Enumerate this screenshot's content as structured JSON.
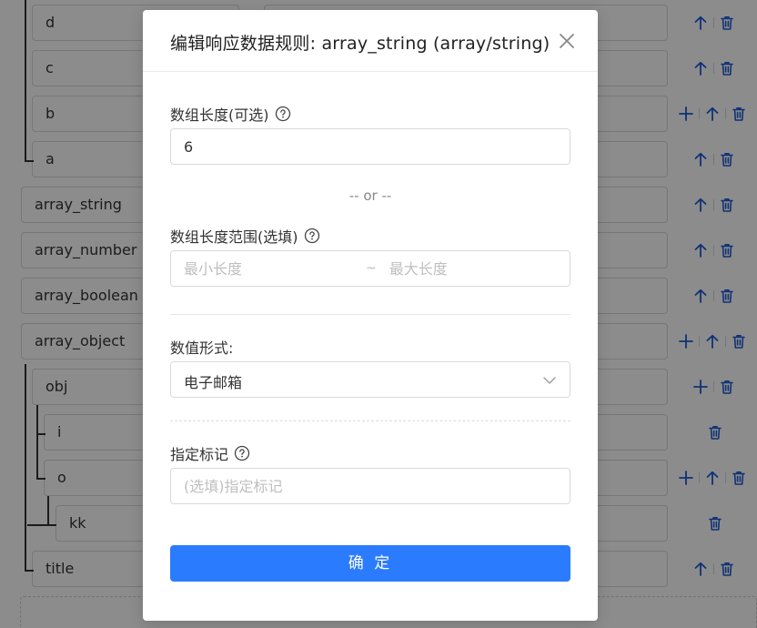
{
  "tree": {
    "rows": [
      {
        "name": "d",
        "actions": [
          "up",
          "delete"
        ]
      },
      {
        "name": "c",
        "actions": [
          "up",
          "delete"
        ]
      },
      {
        "name": "b",
        "actions": [
          "add",
          "up",
          "delete"
        ]
      },
      {
        "name": "a",
        "actions": [
          "up",
          "delete"
        ]
      },
      {
        "name": "array_string",
        "actions": [
          "up",
          "delete"
        ]
      },
      {
        "name": "array_number",
        "actions": [
          "up",
          "delete"
        ]
      },
      {
        "name": "array_boolean",
        "actions": [
          "up",
          "delete"
        ]
      },
      {
        "name": "array_object",
        "actions": [
          "add",
          "up",
          "delete"
        ]
      },
      {
        "name": "obj",
        "actions": [
          "add",
          "delete"
        ]
      },
      {
        "name": "i",
        "actions": [
          "delete"
        ]
      },
      {
        "name": "o",
        "actions": [
          "add",
          "up",
          "delete"
        ]
      },
      {
        "name": "kk",
        "actions": [
          "delete"
        ]
      },
      {
        "name": "title",
        "actions": [
          "up",
          "delete"
        ]
      }
    ]
  },
  "modal": {
    "title": "编辑响应数据规则: array_string (array/string)",
    "array_length_label": "数组长度(可选)",
    "array_length_value": "6",
    "or_text": "-- or --",
    "range_label": "数组长度范围(选填)",
    "range_min_placeholder": "最小长度",
    "range_sep": "~",
    "range_max_placeholder": "最大长度",
    "value_format_label": "数值形式:",
    "value_format_selected": "电子邮箱",
    "tag_label": "指定标记",
    "tag_placeholder": "(选填)指定标记",
    "confirm_label": "确 定"
  },
  "colors": {
    "primary": "#2b7bff",
    "action_icon": "#1d5bd6"
  },
  "icons": {
    "close": "close-icon",
    "help": "help-circle-icon",
    "select_arrow": "chevron-down-icon",
    "add": "plus-icon",
    "up": "arrow-up-icon",
    "delete": "trash-icon"
  }
}
